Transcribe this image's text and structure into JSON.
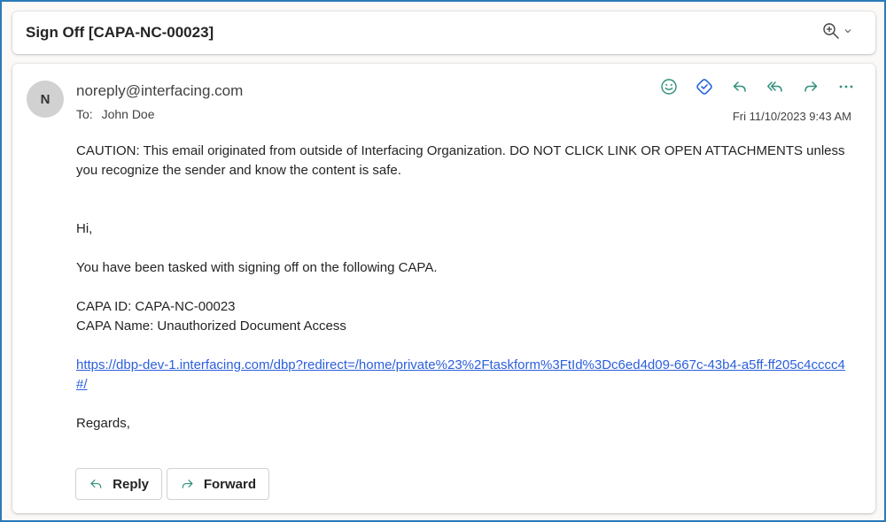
{
  "subject": "Sign Off [CAPA-NC-00023]",
  "toolbar": {
    "zoom_icon": "zoom-in-icon",
    "dropdown_icon": "chevron-down-icon"
  },
  "message": {
    "avatar_initial": "N",
    "sender": "noreply@interfacing.com",
    "to_label": "To:",
    "to_name": "John Doe",
    "date": "Fri 11/10/2023 9:43 AM",
    "actions": [
      "emoji-icon",
      "loop-icon",
      "reply-icon",
      "reply-all-icon",
      "forward-icon",
      "more-icon"
    ],
    "caution": "CAUTION: This email originated from outside of Interfacing Organization. DO NOT CLICK LINK OR OPEN ATTACHMENTS unless you recognize the sender and know the content is safe.",
    "greeting": "Hi,",
    "intro": "You have been tasked with signing off on the following CAPA.",
    "capa_id": "CAPA ID: CAPA-NC-00023",
    "capa_name": "CAPA Name: Unauthorized Document Access",
    "link": "https://dbp-dev-1.interfacing.com/dbp?redirect=/home/private%23%2Ftaskform%3FtId%3Dc6ed4d09-667c-43b4-a5ff-ff205c4cccc4#/",
    "closing": "Regards,"
  },
  "buttons": {
    "reply_label": "Reply",
    "forward_label": "Forward"
  },
  "colors": {
    "accent": "#0f6cbd",
    "icon_green": "#2f8f7a",
    "icon_blue": "#2563d9",
    "link": "#2b5fdc",
    "frame": "#2a7ab8"
  }
}
